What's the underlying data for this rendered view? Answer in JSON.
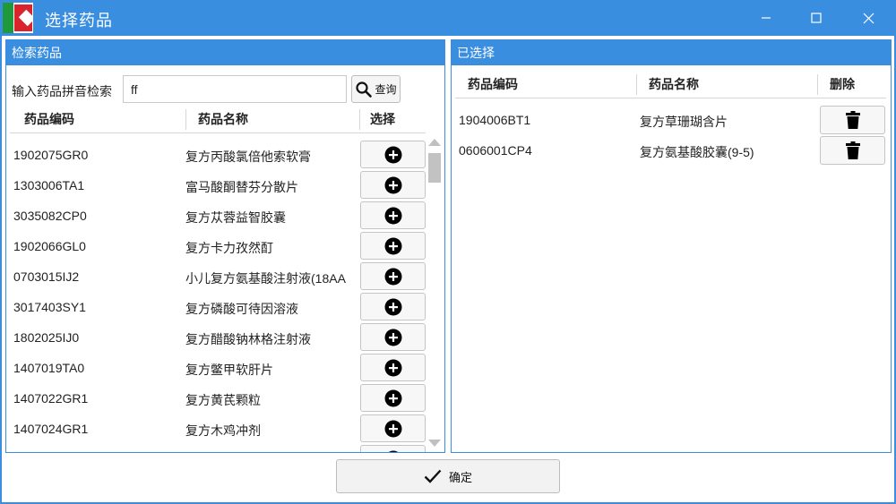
{
  "window": {
    "title": "选择药品"
  },
  "left_panel": {
    "title": "检索药品",
    "search_label": "输入药品拼音检索",
    "search_value": "ff",
    "query_label": "查询",
    "columns": [
      "药品编码",
      "药品名称",
      "选择"
    ],
    "rows": [
      {
        "code": "1902075GR0",
        "name": "复方丙酸氯倍他索软膏"
      },
      {
        "code": "1303006TA1",
        "name": "富马酸酮替芬分散片"
      },
      {
        "code": "3035082CP0",
        "name": "复方苁蓉益智胶囊"
      },
      {
        "code": "1902066GL0",
        "name": "复方卡力孜然酊"
      },
      {
        "code": "0703015IJ2",
        "name": "小儿复方氨基酸注射液(18AA"
      },
      {
        "code": "3017403SY1",
        "name": "复方磷酸可待因溶液"
      },
      {
        "code": "1802025IJ0",
        "name": "复方醋酸钠林格注射液"
      },
      {
        "code": "1407019TA0",
        "name": "复方鳖甲软肝片"
      },
      {
        "code": "1407022GR1",
        "name": "复方黄芪颗粒"
      },
      {
        "code": "1407024GR1",
        "name": "复方木鸡冲剂"
      },
      {
        "code": "",
        "name": ""
      }
    ]
  },
  "right_panel": {
    "title": "已选择",
    "columns": [
      "药品编码",
      "药品名称",
      "删除"
    ],
    "rows": [
      {
        "code": "1904006BT1",
        "name": "复方草珊瑚含片"
      },
      {
        "code": "0606001CP4",
        "name": "复方氨基酸胶囊(9-5)"
      }
    ]
  },
  "footer": {
    "confirm_label": "确定"
  },
  "icons": {
    "search": "search-icon",
    "add": "plus-circle-icon",
    "delete": "trash-icon",
    "confirm": "check-icon"
  },
  "colors": {
    "accent": "#3a8ee0",
    "logo_red": "#d9232d",
    "logo_green": "#1e9a3a"
  }
}
